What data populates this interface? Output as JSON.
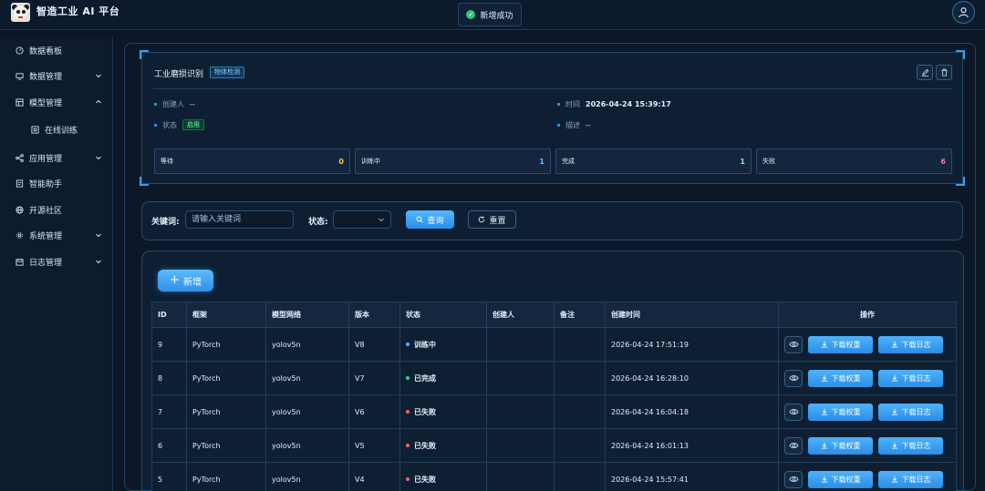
{
  "app": {
    "title": "智造工业 AI 平台"
  },
  "toast": {
    "message": "新增成功"
  },
  "sidebar": {
    "items": [
      {
        "label": "数据看板",
        "icon": "dashboard-icon"
      },
      {
        "label": "数据管理",
        "icon": "database-icon",
        "expandable": true,
        "expanded": false
      },
      {
        "label": "模型管理",
        "icon": "model-icon",
        "expandable": true,
        "expanded": true
      },
      {
        "label": "在线训练",
        "icon": "train-icon",
        "sub": true
      },
      {
        "label": "应用管理",
        "icon": "apps-icon",
        "expandable": true,
        "expanded": false
      },
      {
        "label": "智能助手",
        "icon": "assistant-icon"
      },
      {
        "label": "开源社区",
        "icon": "globe-icon"
      },
      {
        "label": "系统管理",
        "icon": "gear-icon",
        "expandable": true,
        "expanded": false
      },
      {
        "label": "日志管理",
        "icon": "calendar-icon",
        "expandable": true,
        "expanded": false
      }
    ]
  },
  "detail": {
    "title": "工业磨损识别",
    "tag": "物体检测",
    "creator_label": "创建人",
    "creator_value": "--",
    "time_label": "时间",
    "time_value": "2026-04-24 15:39:17",
    "status_label": "状态",
    "status_value": "启用",
    "desc_label": "描述",
    "desc_value": "--",
    "stats": [
      {
        "label": "等待",
        "value": "0",
        "color": "#f5c342"
      },
      {
        "label": "训练中",
        "value": "1",
        "color": "#5cc6ff"
      },
      {
        "label": "完成",
        "value": "1",
        "color": "#8fe3c0"
      },
      {
        "label": "失败",
        "value": "6",
        "color": "#ff7a8a"
      }
    ]
  },
  "filter": {
    "keyword_label": "关键词:",
    "keyword_placeholder": "请输入关键词",
    "status_label": "状态:",
    "search_label": "查询",
    "reset_label": "重置"
  },
  "table": {
    "add_label": "新增",
    "columns": [
      "ID",
      "框架",
      "模型网络",
      "版本",
      "状态",
      "创建人",
      "备注",
      "创建时间",
      "操作"
    ],
    "download_weights_label": "下载权重",
    "download_log_label": "下载日志",
    "rows": [
      {
        "id": "9",
        "framework": "PyTorch",
        "network": "yolov5n",
        "version": "V8",
        "status": "训练中",
        "status_color": "#4fb3ff",
        "creator": "",
        "note": "",
        "created": "2026-04-24 17:51:19"
      },
      {
        "id": "8",
        "framework": "PyTorch",
        "network": "yolov5n",
        "version": "V7",
        "status": "已完成",
        "status_color": "#3fcf7e",
        "creator": "",
        "note": "",
        "created": "2026-04-24 16:28:10"
      },
      {
        "id": "7",
        "framework": "PyTorch",
        "network": "yolov5n",
        "version": "V6",
        "status": "已失败",
        "status_color": "#ff5c6c",
        "creator": "",
        "note": "",
        "created": "2026-04-24 16:04:18"
      },
      {
        "id": "6",
        "framework": "PyTorch",
        "network": "yolov5n",
        "version": "V5",
        "status": "已失败",
        "status_color": "#ff5c6c",
        "creator": "",
        "note": "",
        "created": "2026-04-24 16:01:13"
      },
      {
        "id": "5",
        "framework": "PyTorch",
        "network": "yolov5n",
        "version": "V4",
        "status": "已失败",
        "status_color": "#ff5c6c",
        "creator": "",
        "note": "",
        "created": "2026-04-24 15:57:41"
      }
    ]
  }
}
